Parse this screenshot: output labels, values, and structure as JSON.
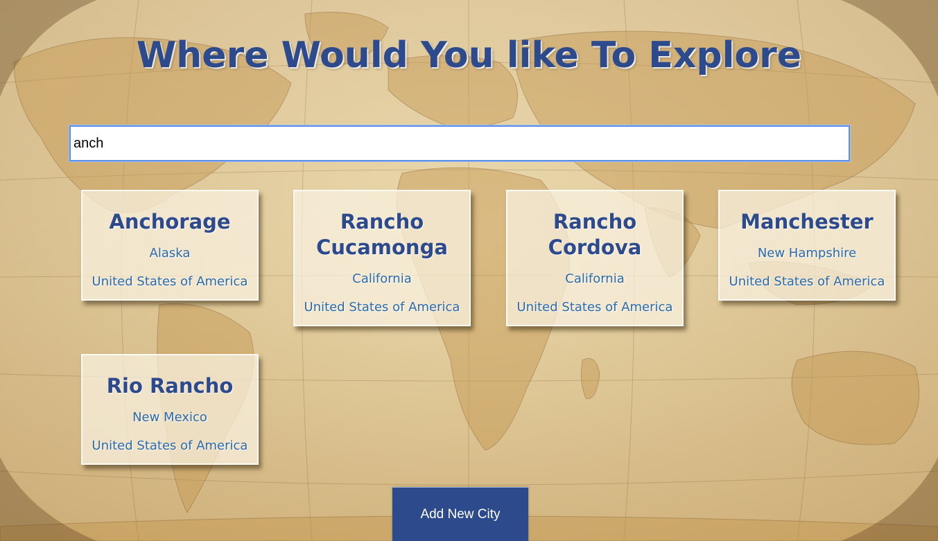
{
  "page": {
    "title": "Where Would You like To Explore"
  },
  "search": {
    "value": "anch",
    "placeholder": ""
  },
  "results": [
    {
      "city": "Anchorage",
      "state": "Alaska",
      "country": "United States of America"
    },
    {
      "city": "Rancho Cucamonga",
      "state": "California",
      "country": "United States of America"
    },
    {
      "city": "Rancho Cordova",
      "state": "California",
      "country": "United States of America"
    },
    {
      "city": "Manchester",
      "state": "New Hampshire",
      "country": "United States of America"
    },
    {
      "city": "Rio Rancho",
      "state": "New Mexico",
      "country": "United States of America"
    }
  ],
  "actions": {
    "add_city_label": "Add New City"
  },
  "colors": {
    "title": "#2c4a8c",
    "card_text": "#2b6aa8",
    "button_bg": "#2c4a8c",
    "search_border": "#5b8ee6"
  }
}
